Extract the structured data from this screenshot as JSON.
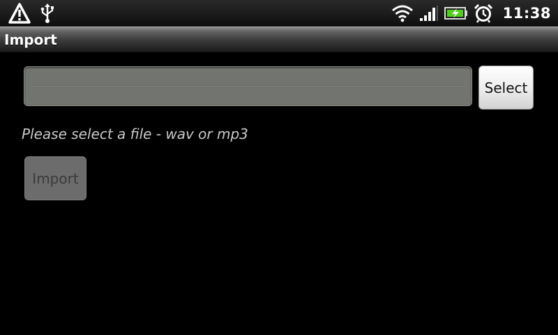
{
  "status_bar": {
    "time": "11:38",
    "icons": [
      "warning-icon",
      "usb-icon",
      "wifi-icon",
      "signal-icon",
      "battery-icon",
      "alarm-icon"
    ],
    "battery_color": "#4fd11c"
  },
  "title_bar": {
    "title": "Import"
  },
  "form": {
    "file_value": "",
    "file_placeholder": "",
    "select_label": "Select",
    "hint": "Please select a file - wav or mp3",
    "import_label": "Import",
    "import_enabled": false
  }
}
